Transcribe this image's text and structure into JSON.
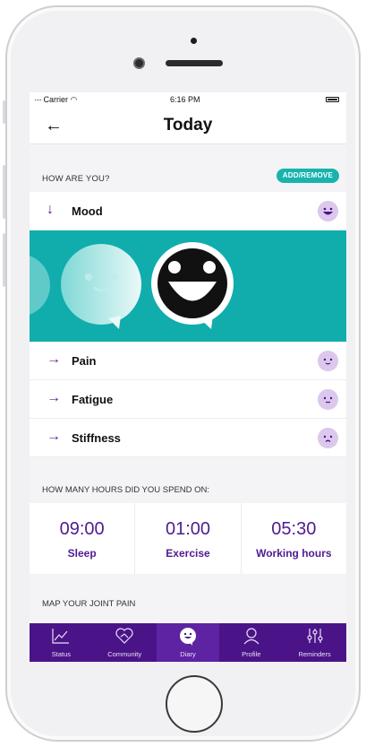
{
  "status_bar": {
    "carrier": "Carrier",
    "time": "6:16 PM"
  },
  "nav": {
    "title": "Today",
    "back_icon": "arrow-left-icon"
  },
  "how_are_you": {
    "heading": "HOW ARE YOU?",
    "add_remove_label": "ADD/REMOVE",
    "items": [
      {
        "label": "Mood",
        "state": "expanded"
      },
      {
        "label": "Pain",
        "state": "collapsed"
      },
      {
        "label": "Fatigue",
        "state": "collapsed"
      },
      {
        "label": "Stiffness",
        "state": "collapsed"
      }
    ]
  },
  "hours": {
    "heading": "HOW MANY HOURS DID YOU SPEND ON:",
    "items": [
      {
        "value": "09:00",
        "label": "Sleep"
      },
      {
        "value": "01:00",
        "label": "Exercise"
      },
      {
        "value": "05:30",
        "label": "Working hours"
      }
    ]
  },
  "map": {
    "heading": "MAP YOUR JOINT PAIN"
  },
  "tabs": [
    {
      "label": "Status",
      "icon": "chart-icon",
      "active": false
    },
    {
      "label": "Community",
      "icon": "heart-handshake-icon",
      "active": false
    },
    {
      "label": "Diary",
      "icon": "smile-bubble-icon",
      "active": true
    },
    {
      "label": "Profile",
      "icon": "person-icon",
      "active": false
    },
    {
      "label": "Reminders",
      "icon": "sliders-icon",
      "active": false
    }
  ],
  "colors": {
    "accent": "#10adac",
    "brand": "#4a1488",
    "face": "#dcc8ec"
  }
}
